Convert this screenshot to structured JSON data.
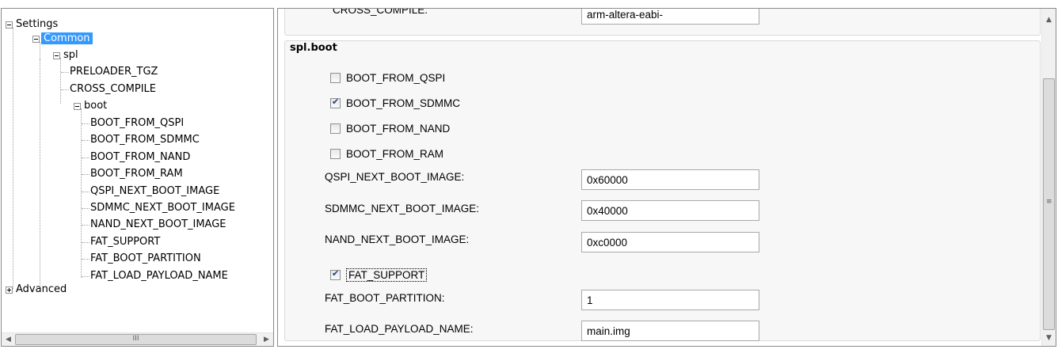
{
  "tree": {
    "root": "Settings",
    "common": "Common",
    "spl": "spl",
    "spl_children": [
      "PRELOADER_TGZ",
      "CROSS_COMPILE"
    ],
    "boot": "boot",
    "boot_children": [
      "BOOT_FROM_QSPI",
      "BOOT_FROM_SDMMC",
      "BOOT_FROM_NAND",
      "BOOT_FROM_RAM",
      "QSPI_NEXT_BOOT_IMAGE",
      "SDMMC_NEXT_BOOT_IMAGE",
      "NAND_NEXT_BOOT_IMAGE",
      "FAT_SUPPORT",
      "FAT_BOOT_PARTITION",
      "FAT_LOAD_PAYLOAD_NAME"
    ],
    "advanced": "Advanced",
    "scroll_grip": "III"
  },
  "form": {
    "cross_compile": {
      "label": "CROSS_COMPILE:",
      "value": "arm-altera-eabi-"
    },
    "group_title": "spl.boot",
    "checkboxes": [
      {
        "label": "BOOT_FROM_QSPI",
        "checked": false
      },
      {
        "label": "BOOT_FROM_SDMMC",
        "checked": true
      },
      {
        "label": "BOOT_FROM_NAND",
        "checked": false
      },
      {
        "label": "BOOT_FROM_RAM",
        "checked": false
      }
    ],
    "qspi": {
      "label": "QSPI_NEXT_BOOT_IMAGE:",
      "value": "0x60000"
    },
    "sdmmc": {
      "label": "SDMMC_NEXT_BOOT_IMAGE:",
      "value": "0x40000"
    },
    "nand": {
      "label": "NAND_NEXT_BOOT_IMAGE:",
      "value": "0xc0000"
    },
    "fat_support": {
      "label": "FAT_SUPPORT",
      "checked": true
    },
    "fat_boot_partition": {
      "label": "FAT_BOOT_PARTITION:",
      "value": "1"
    },
    "fat_load_payload": {
      "label": "FAT_LOAD_PAYLOAD_NAME:",
      "value": "main.img"
    }
  },
  "icons": {
    "up": "scroll-up-arrow",
    "down": "scroll-down-arrow",
    "left": "scroll-left-arrow",
    "right": "scroll-right-arrow"
  }
}
